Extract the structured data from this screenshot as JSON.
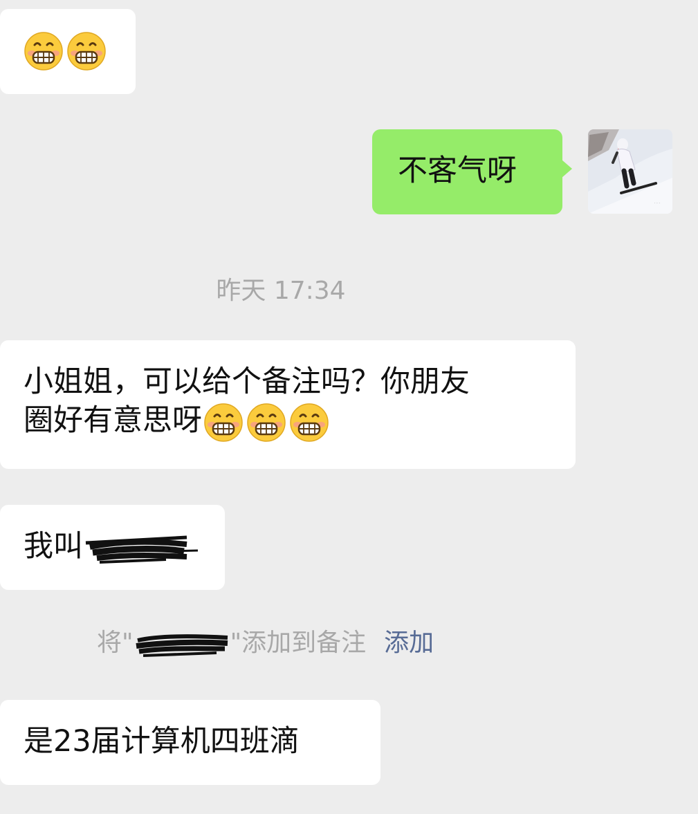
{
  "messages": {
    "m1": {
      "emoji_icon": "grin-emoji",
      "emoji_count": 2
    },
    "m2": {
      "text": "不客气呀",
      "avatar_icon": "snowboarder-photo-avatar"
    },
    "time1": "昨天 17:34",
    "m3": {
      "line1": "小姐姐，可以给个备注吗？你朋友",
      "line2": "圈好有意思呀",
      "emoji_count": 3
    },
    "m4": {
      "text": "我叫"
    },
    "sys": {
      "prefix": "将\"",
      "suffix": "\"添加到备注",
      "link": "添加"
    },
    "m5": {
      "text": "是23届计算机四班滴"
    }
  },
  "colors": {
    "background": "#ededed",
    "incoming_bubble": "#ffffff",
    "outgoing_bubble": "#95ec69",
    "system_text": "#a8a8a8",
    "link": "#576b95"
  }
}
